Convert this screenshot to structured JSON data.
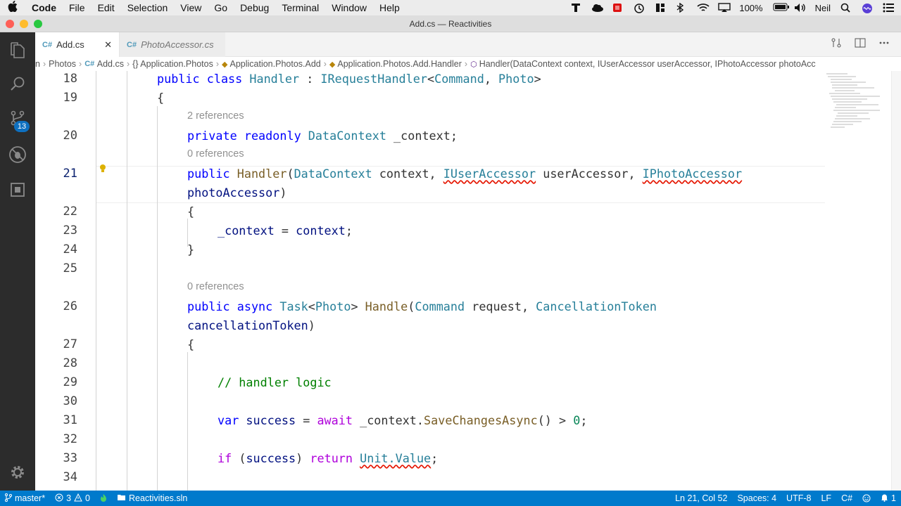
{
  "menubar": {
    "app": "Code",
    "items": [
      "File",
      "Edit",
      "Selection",
      "View",
      "Go",
      "Debug",
      "Terminal",
      "Window",
      "Help"
    ],
    "battery": "100%",
    "user": "Neil"
  },
  "window": {
    "title": "Add.cs — Reactivities"
  },
  "activity": {
    "scm_badge": "13"
  },
  "tabs": [
    {
      "icon": "C#",
      "label": "Add.cs",
      "close": "✕"
    },
    {
      "icon": "C#",
      "label": "PhotoAccessor.cs"
    }
  ],
  "breadcrumb": {
    "items": [
      "Photos",
      "Add.cs",
      "{} Application.Photos",
      "Application.Photos.Add",
      "Application.Photos.Add.Handler",
      "Handler(DataContext context, IUserAccessor userAccessor, IPhotoAccessor photoAcc"
    ],
    "lead": "n"
  },
  "editor": {
    "line_numbers": [
      "18",
      "19",
      "20",
      "21",
      "22",
      "23",
      "24",
      "25",
      "26",
      "27",
      "28",
      "29",
      "30",
      "31",
      "32",
      "33",
      "34"
    ],
    "lenses": [
      "2 references",
      "0 references",
      "0 references"
    ],
    "code": {
      "l18_public": "public",
      "l18_class": "class",
      "l18_handler": "Handler",
      "l18_colon": " : ",
      "l18_ireq": "IRequestHandler",
      "l18_lt": "<",
      "l18_cmd": "Command",
      "l18_comma": ", ",
      "l18_photo": "Photo",
      "l18_gt": ">",
      "l19": "{",
      "l20_private": "private",
      "l20_readonly": "readonly",
      "l20_dc": "DataContext",
      "l20_rest": " _context;",
      "l21_public": "public",
      "l21_handler": "Handler",
      "l21_paren": "(",
      "l21_dc": "DataContext",
      "l21_ctx": " context, ",
      "l21_iua": "IUserAccessor",
      "l21_ua": " userAccessor, ",
      "l21_ipa": "IPhotoAccessor",
      "l21b_pa": "photoAccessor",
      "l21b_close": ")",
      "l22": "{",
      "l23_ctx": "_context",
      "l23_eq": " = ",
      "l23_val": "context",
      "l23_semi": ";",
      "l24": "}",
      "l26_public": "public",
      "l26_async": "async",
      "l26_task": "Task",
      "l26_lt": "<",
      "l26_photo": "Photo",
      "l26_gt": "> ",
      "l26_handle": "Handle",
      "l26_paren": "(",
      "l26_cmd": "Command",
      "l26_req": " request, ",
      "l26_ct": "CancellationToken",
      "l26b_ct": "cancellationToken",
      "l26b_close": ")",
      "l27": "{",
      "l29": "// handler logic",
      "l31_var": "var",
      "l31_succ": " success",
      "l31_eq": " = ",
      "l31_await": "await",
      "l31_ctx": " _context.",
      "l31_save": "SaveChangesAsync",
      "l31_paren": "()",
      "l31_gt": " > ",
      "l31_zero": "0",
      "l31_semi": ";",
      "l33_if": "if",
      "l33_paren": " (",
      "l33_succ": "success",
      "l33_close": ") ",
      "l33_return": "return",
      "l33_unit": "Unit.Value",
      "l33_semi": ";"
    }
  },
  "status": {
    "branch": "master*",
    "errors": "3",
    "warnings": "0",
    "solution": "Reactivities.sln",
    "position": "Ln 21, Col 52",
    "spaces": "Spaces: 4",
    "encoding": "UTF-8",
    "eol": "LF",
    "language": "C#",
    "notifications": "1"
  },
  "colors": {
    "statusbar": "#007acc",
    "activitybar": "#2c2c2c",
    "keyword": "#0000ff",
    "type": "#267f99"
  }
}
